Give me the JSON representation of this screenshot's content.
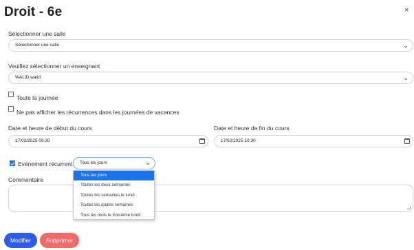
{
  "dialog": {
    "title": "Droit - 6e",
    "close_symbol": "×"
  },
  "room": {
    "label": "Sélectionner une salle",
    "value": "Sélectionner une salle"
  },
  "teacher": {
    "label": "Veuillez sélectionner un enseignant",
    "value": "WALID walid"
  },
  "all_day": {
    "label": "Toute la journée",
    "checked": false
  },
  "skip_holidays": {
    "label": "Ne pas afficher les récurrences dans les journées de vacances",
    "checked": false
  },
  "start": {
    "label": "Date et heure de début du cours",
    "value": "17/02/2025 09:30"
  },
  "end": {
    "label": "Date et heure de fin du cours",
    "value": "17/02/2025 10:30"
  },
  "recurring": {
    "label": "Evénement récurrent",
    "checked": true,
    "selected": "Tous les jours",
    "options": [
      "Tous les jours",
      "Toutes les deux semaines",
      "Toutes les semaines le lundi",
      "Toutes les quatre semaines",
      "Tous les mois le troisième lundi"
    ]
  },
  "comment": {
    "label": "Commentaire",
    "value": ""
  },
  "buttons": {
    "modify": "Modifier",
    "delete": "Supprimer"
  },
  "colors": {
    "accent": "#1a73e8",
    "primary_button": "#2f5bea",
    "danger_button": "#f06a6a"
  }
}
